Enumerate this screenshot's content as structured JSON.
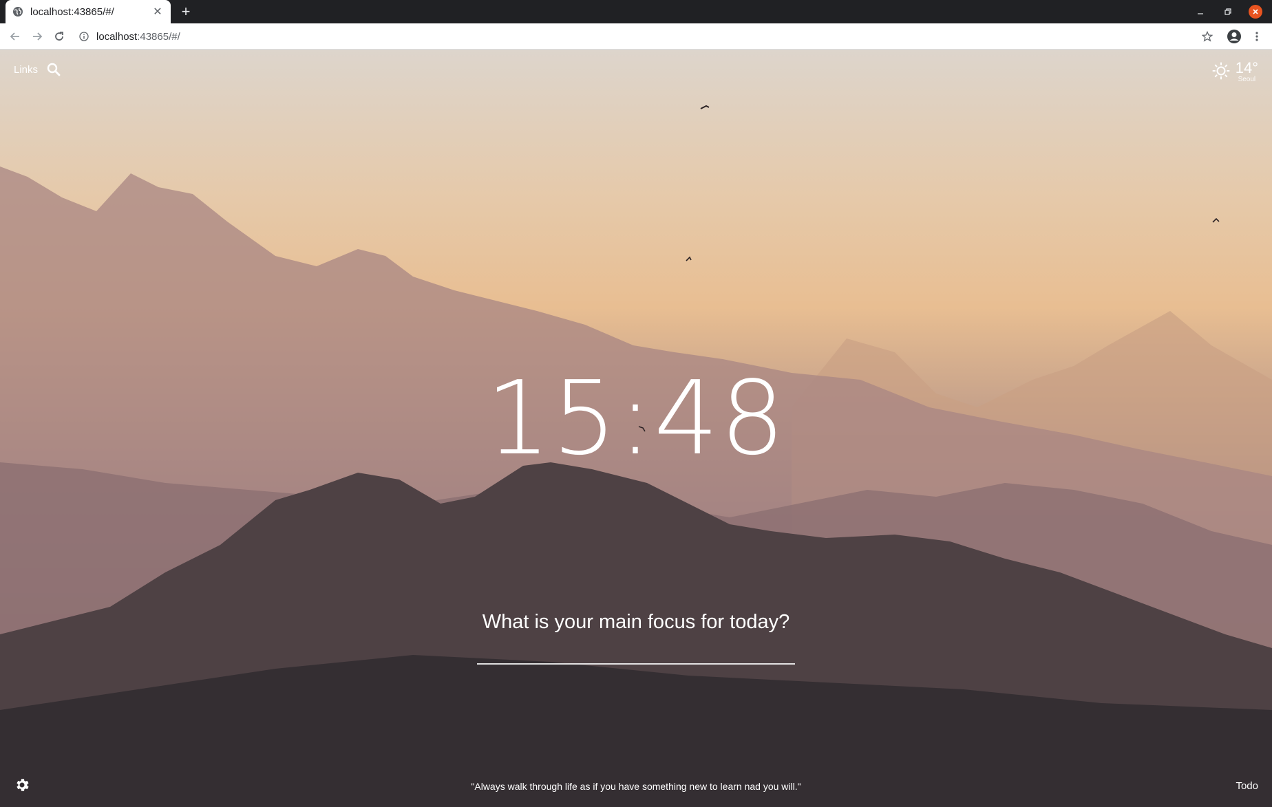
{
  "browser": {
    "tab_title": "localhost:43865/#/",
    "new_tab_label": "+",
    "url_host": "localhost",
    "url_rest": ":43865/#/"
  },
  "links": {
    "label": "Links"
  },
  "weather": {
    "temperature": "14°",
    "city": "Seoul",
    "icon": "sun-icon"
  },
  "clock": {
    "time": "15:48"
  },
  "focus": {
    "question": "What is your main focus for today?",
    "value": ""
  },
  "footer": {
    "quote": "\"Always walk through life as if you have something new to learn nad you will.\"",
    "todo_label": "Todo"
  },
  "colors": {
    "tab_strip": "#202124",
    "close_button": "#e95420",
    "sky_top": "#ddd5cc",
    "sky_glow": "#e8be92",
    "foreground": "#2d2a2f"
  }
}
